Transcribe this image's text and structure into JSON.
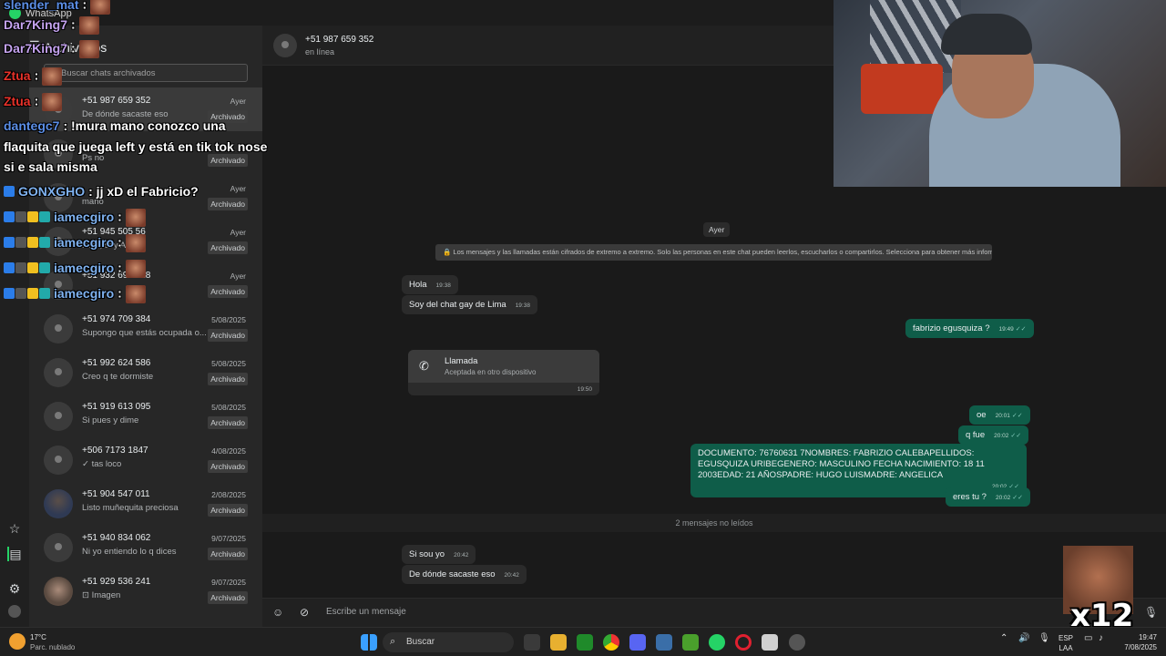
{
  "titlebar": {
    "app_name": "WhatsApp"
  },
  "sidebar": {
    "title": "Archivados",
    "search_placeholder": "Buscar chats archivados",
    "chats": [
      {
        "name": "+51 987 659 352",
        "date": "Ayer",
        "preview": "De dónde sacaste eso",
        "badge": "Archivado",
        "selected": true,
        "avatar": "default"
      },
      {
        "name": "",
        "date": "",
        "preview": "Ps no",
        "badge": "Archivado",
        "avatar": "default"
      },
      {
        "name": "",
        "date": "Ayer",
        "preview": "mano",
        "badge": "Archivado",
        "avatar": "default"
      },
      {
        "name": "+51 945 505 56",
        "date": "Ayer",
        "preview": "Hola, soy Aldo",
        "badge": "Archivado",
        "avatar": "default"
      },
      {
        "name": "+51 932 696 428",
        "date": "Ayer",
        "preview": "",
        "badge": "Archivado",
        "avatar": "default"
      },
      {
        "name": "+51 974 709 384",
        "date": "5/08/2025",
        "preview": "Supongo que estás ocupada o...",
        "badge": "Archivado",
        "avatar": "default"
      },
      {
        "name": "+51 992 624 586",
        "date": "5/08/2025",
        "preview": "Creo q te dormiste",
        "badge": "Archivado",
        "avatar": "default"
      },
      {
        "name": "+51 919 613 095",
        "date": "5/08/2025",
        "preview": "Si pues y dime",
        "badge": "Archivado",
        "avatar": "default"
      },
      {
        "name": "+506 7173 1847",
        "date": "4/08/2025",
        "preview": "✓ tas loco",
        "badge": "Archivado",
        "avatar": "default"
      },
      {
        "name": "+51 904 547 011",
        "date": "2/08/2025",
        "preview": "Listo muñequita preciosa",
        "badge": "Archivado",
        "avatar": "photo1"
      },
      {
        "name": "+51 940 834 062",
        "date": "9/07/2025",
        "preview": "Ni yo entiendo lo q dices",
        "badge": "Archivado",
        "avatar": "default"
      },
      {
        "name": "+51 929 536 241",
        "date": "9/07/2025",
        "preview": "⊡ Imagen",
        "badge": "Archivado",
        "avatar": "photo2"
      }
    ]
  },
  "conversation": {
    "contact_name": "+51 987 659 352",
    "status": "en línea",
    "day_label": "Ayer",
    "encryption_notice": "🔒 Los mensajes y las llamadas están cifrados de extremo a extremo. Solo las personas en este chat pueden leerlos, escucharlos o compartirlos. Selecciona para obtener más información.",
    "messages": [
      {
        "text": "Hola",
        "time": "19:38"
      },
      {
        "text": "Soy del chat gay de Lima",
        "time": "19:38"
      },
      {
        "text": "fabrizio egusquiza ?",
        "time": "19:49"
      },
      {
        "text": "oe",
        "time": "20:01"
      },
      {
        "text": "q fue",
        "time": "20:02"
      },
      {
        "text": "DOCUMENTO: 76760631 7NOMBRES: FABRIZIO CALEBAPELLIDOS: EGUSQUIZA URIBEGENERO: MASCULINO FECHA NACIMIENTO: 18 11 2003EDAD: 21 AÑOSPADRE: HUGO LUISMADRE: ANGELICA",
        "time": "20:02"
      },
      {
        "text": "eres tu ?",
        "time": "20:02"
      },
      {
        "text": "Si sou yo",
        "time": "20:42"
      },
      {
        "text": "De dónde sacaste eso",
        "time": "20:42"
      }
    ],
    "call": {
      "title": "Llamada",
      "subtitle": "Aceptada en otro dispositivo",
      "time": "19:50"
    },
    "unread_divider": "2 mensajes no leídos",
    "compose_placeholder": "Escribe un mensaje"
  },
  "stream_chat": [
    {
      "user": "slender_mat",
      "message": ":",
      "color": "#5b8ee6"
    },
    {
      "user": "Dar7King7",
      "message": ":",
      "color": "#c5a3f0"
    },
    {
      "user": "Dar7King7",
      "message": ":",
      "color": "#c5a3f0"
    },
    {
      "user": "Ztua",
      "message": ":",
      "color": "#e8322a"
    },
    {
      "user": "Ztua",
      "message": ":",
      "color": "#e8322a"
    },
    {
      "user": "dantegc7",
      "message": ": !mura mano conozco una",
      "color": "#5b8ee6"
    },
    {
      "user": "",
      "message": "flaquita que juega left y está en tik tok nose",
      "color": "#ffffff"
    },
    {
      "user": "",
      "message": "si e sala misma",
      "color": "#ffffff"
    },
    {
      "user": "GONXGHO",
      "message": ": jj xD el Fabricio?",
      "color": "#7fb2f0"
    },
    {
      "user": "iamecgiro",
      "message": ":",
      "color": "#7fb2f0"
    },
    {
      "user": "iamecgiro",
      "message": ":",
      "color": "#7fb2f0"
    },
    {
      "user": "iamecgiro",
      "message": ":",
      "color": "#7fb2f0"
    },
    {
      "user": "iamecgiro",
      "message": ":",
      "color": "#7fb2f0"
    }
  ],
  "emote_overlay": {
    "count": "x12"
  },
  "taskbar": {
    "temperature": "17°C",
    "weather": "Parc. nublado",
    "search_label": "Buscar",
    "language_top": "ESP",
    "language_bottom": "LAA",
    "time": "19:47",
    "date": "7/08/2025"
  },
  "colors": {
    "outgoing_bubble": "#0f5d49",
    "incoming_bubble": "#2b2b2b",
    "accent": "#25d366"
  }
}
